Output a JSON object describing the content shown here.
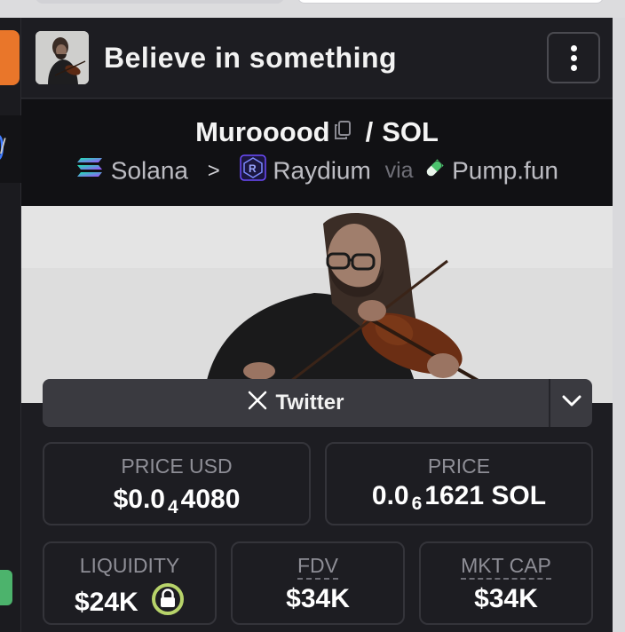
{
  "header": {
    "title": "Believe in something"
  },
  "pair": {
    "base": "Murooood",
    "separator": "/",
    "quote": "SOL"
  },
  "chain": {
    "network": "Solana",
    "dex": "Raydium",
    "via": "via",
    "launchpad": "Pump.fun"
  },
  "social": {
    "twitter_label": "Twitter"
  },
  "stats": {
    "price_usd": {
      "label": "PRICE USD",
      "prefix": "$0.0",
      "zeros": "4",
      "digits": "4080"
    },
    "price": {
      "label": "PRICE",
      "prefix": "0.0",
      "zeros": "6",
      "digits": "1621",
      "unit": "SOL"
    },
    "liquidity": {
      "label": "LIQUIDITY",
      "value": "$24K"
    },
    "fdv": {
      "label": "FDV",
      "value": "$34K"
    },
    "mkt_cap": {
      "label": "MKT CAP",
      "value": "$34K"
    }
  },
  "colors": {
    "panel_bg": "#1d1d22",
    "lock_ring": "#b7d36a",
    "raydium_purple": "#6d4cff"
  },
  "icons": {
    "menu": "kebab-vertical",
    "copy": "copy",
    "twitter": "x-logo",
    "dropdown": "chevron-down",
    "liquidity_locked": "lock"
  }
}
